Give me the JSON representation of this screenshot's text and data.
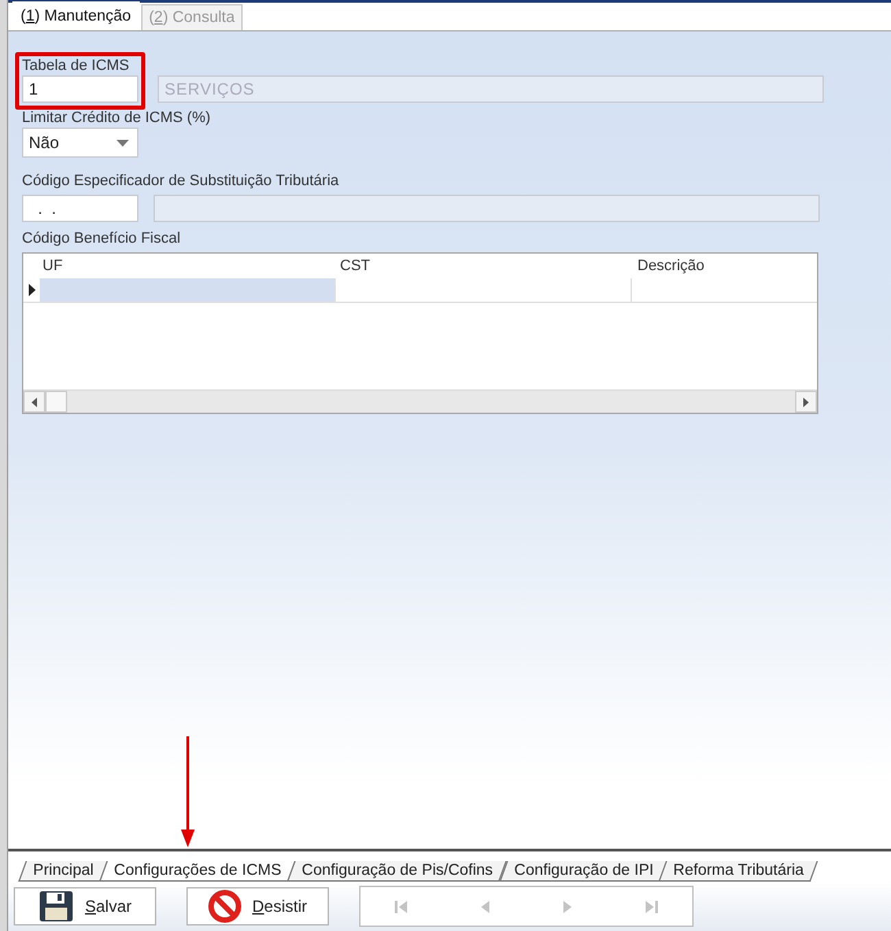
{
  "top_tabs": [
    {
      "prefix": "( ",
      "mnemonic": "1",
      "rest": " ) Manutenção",
      "selected": true
    },
    {
      "prefix": "( ",
      "mnemonic": "2",
      "rest": " ) Consulta",
      "selected": false
    }
  ],
  "form": {
    "tabela_icms": {
      "label": "Tabela de ICMS",
      "value": "1",
      "highlighted": true
    },
    "tabela_descricao": {
      "value": "SERVIÇOS",
      "disabled": true
    },
    "limitar_credito": {
      "label": "Limitar Crédito de ICMS (%)",
      "value": "Não"
    },
    "codigo_especificador": {
      "label": "Código Especificador de Substituição Tributária",
      "value": "  .  .",
      "description_disabled": true
    },
    "beneficio_fiscal": {
      "label": "Código Benefício Fiscal",
      "columns": [
        "UF",
        "CST",
        "Descrição"
      ],
      "rows": [
        {
          "selected": true
        }
      ]
    }
  },
  "annotation_arrow": true,
  "bottom_tabs": [
    {
      "label": "Principal",
      "selected": false
    },
    {
      "label": "Configurações de ICMS",
      "selected": true
    },
    {
      "label": "Configuração de Pis/Cofins",
      "selected": false
    },
    {
      "label": "Configuração de IPI",
      "selected": false
    },
    {
      "label": "Reforma Tributária",
      "selected": false
    }
  ],
  "toolbar": {
    "buttons": [
      {
        "kind": "save",
        "mnemonic": "S",
        "rest": "alvar"
      },
      {
        "kind": "cancel",
        "mnemonic": "D",
        "rest": "esistir"
      }
    ],
    "navigation": [
      {
        "kind": "first",
        "disabled": true
      },
      {
        "kind": "previous",
        "disabled": true
      },
      {
        "kind": "next",
        "disabled": true
      },
      {
        "kind": "last",
        "disabled": true
      }
    ]
  }
}
